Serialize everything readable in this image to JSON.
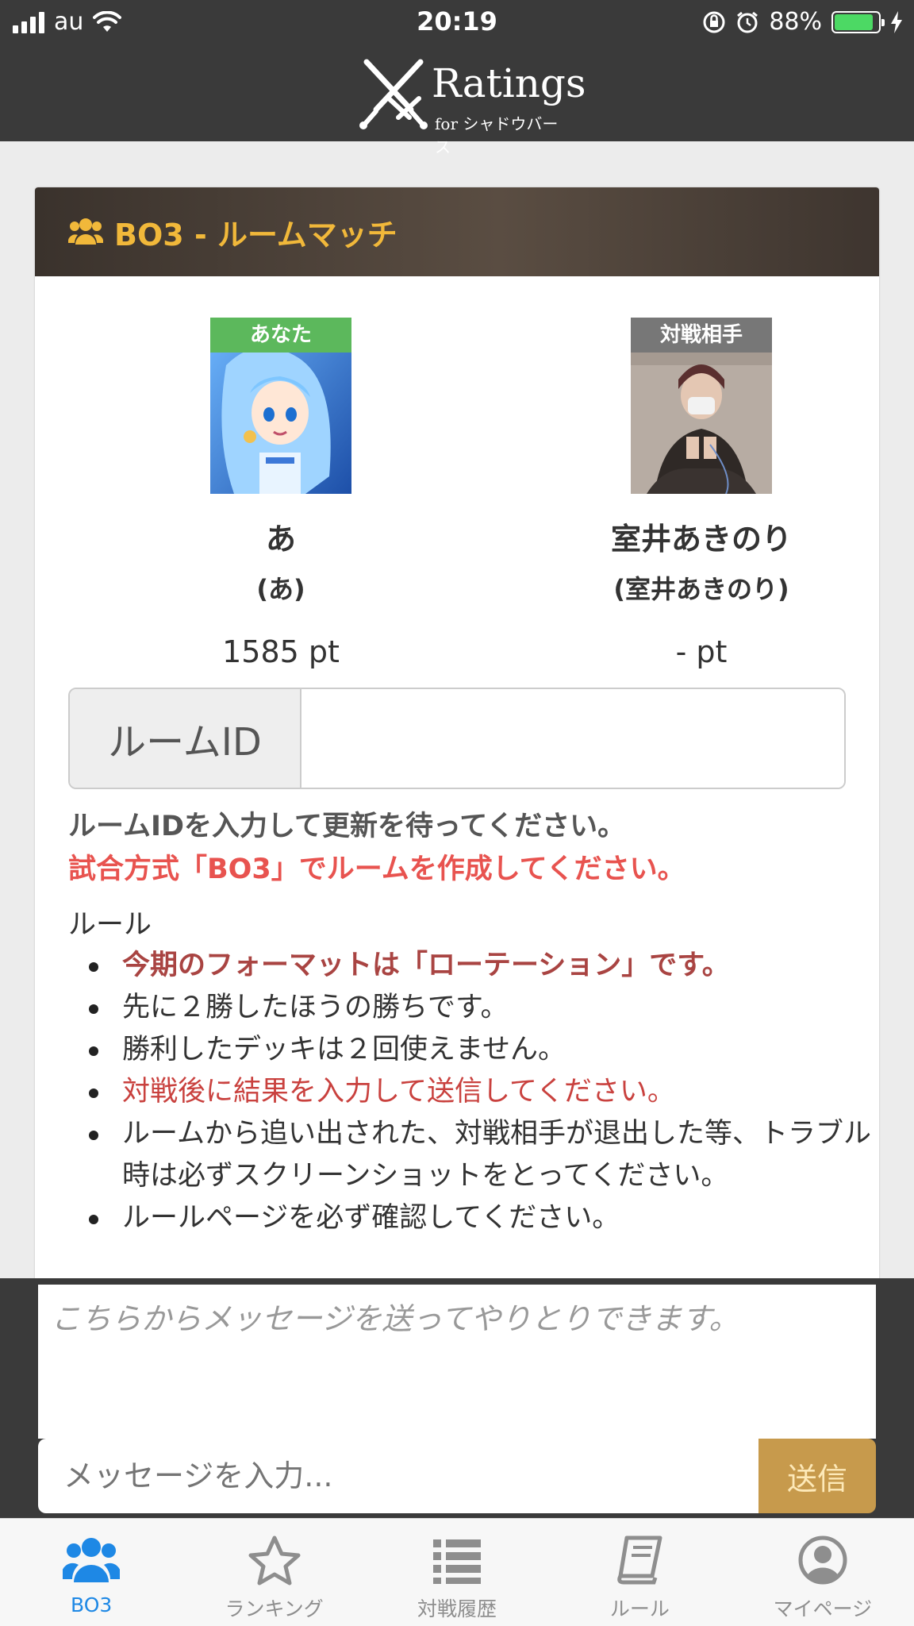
{
  "status_bar": {
    "carrier": "au",
    "time": "20:19",
    "battery": "88%",
    "battery_level": 0.88
  },
  "header": {
    "logo_title": "Ratings",
    "logo_sub": "for シャドウバース"
  },
  "card": {
    "title": "BO3 - ルームマッチ"
  },
  "players": {
    "you": {
      "tag": "あなた",
      "name": "あ",
      "sub": "(あ)",
      "points": "1585 pt",
      "tag_color": "#5cb85c"
    },
    "opponent": {
      "tag": "対戦相手",
      "name": "室井あきのり",
      "sub": "(室井あきのり)",
      "points": "- pt",
      "tag_color": "#777777"
    }
  },
  "room": {
    "label": "ルームID",
    "value": ""
  },
  "notices": {
    "line1": "ルームIDを入力して更新を待ってください。",
    "line2": "試合方式「BO3」でルームを作成してください。"
  },
  "rules": {
    "label": "ルール",
    "items": [
      "今期のフォーマットは「ローテーション」です。",
      "先に２勝したほうの勝ちです。",
      "勝利したデッキは２回使えません。",
      "対戦後に結果を入力して送信してください。",
      "ルームから追い出された、対戦相手が退出した等、トラブル時は必ずスクリーンショットをとってください。",
      "ルールページを必ず確認してください。"
    ]
  },
  "chat": {
    "placeholder": "こちらからメッセージを送ってやりとりできます。",
    "input_placeholder": "メッセージを入力...",
    "send_label": "送信"
  },
  "tabs": [
    {
      "label": "BO3",
      "icon": "users-icon",
      "active": true
    },
    {
      "label": "ランキング",
      "icon": "star-icon",
      "active": false
    },
    {
      "label": "対戦履歴",
      "icon": "list-icon",
      "active": false
    },
    {
      "label": "ルール",
      "icon": "book-icon",
      "active": false
    },
    {
      "label": "マイページ",
      "icon": "user-circle-icon",
      "active": false
    }
  ],
  "colors": {
    "accent": "#1e88e5",
    "header_title": "#f1b83a",
    "send_button": "#c79a4c",
    "warning_red": "#e8534f",
    "rule_strong": "#a94442"
  }
}
